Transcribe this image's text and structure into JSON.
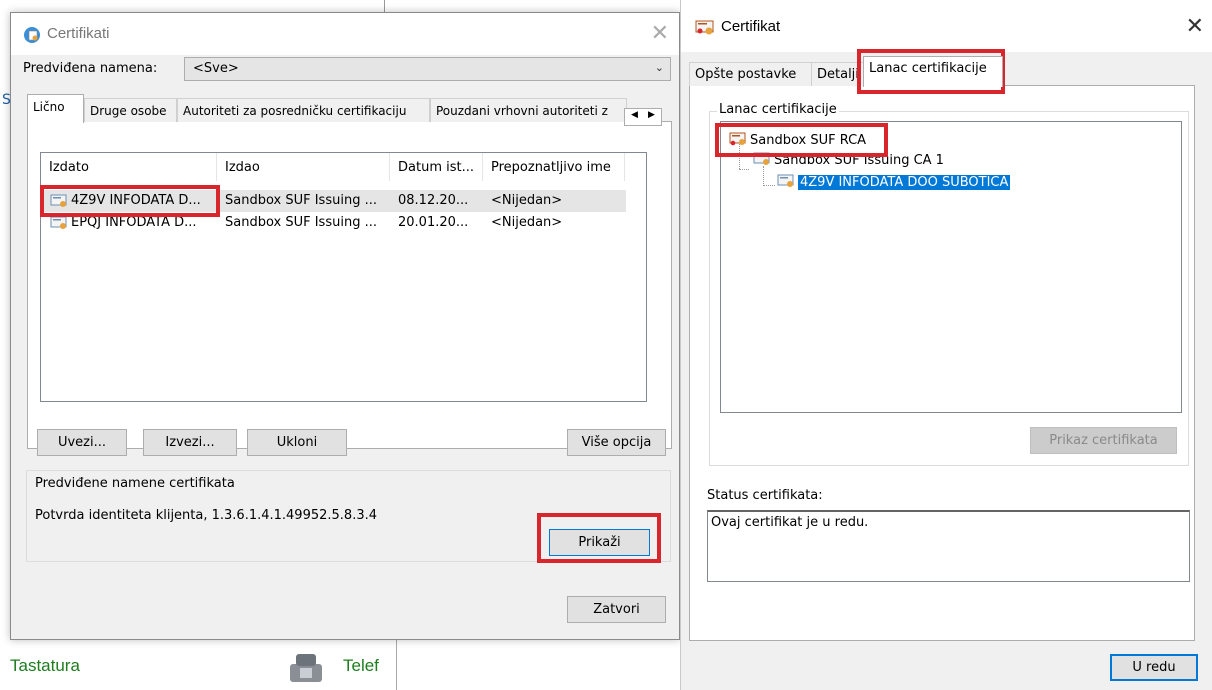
{
  "background": {
    "tastatura": "Tastatura",
    "telefon": "Telef",
    "edge_letter": "S"
  },
  "certifikati": {
    "title": "Certifikati",
    "purpose_label": "Predviđena namena:",
    "purpose_value": "<Sve>",
    "tabs": [
      {
        "label": "Lično"
      },
      {
        "label": "Druge osobe"
      },
      {
        "label": "Autoriteti za posredničku certifikaciju"
      },
      {
        "label": "Pouzdani vrhovni autoriteti z"
      }
    ],
    "columns": [
      "Izdato",
      "Izdao",
      "Datum ist...",
      "Prepoznatljivo ime"
    ],
    "rows": [
      {
        "issued_to": "4Z9V INFODATA D...",
        "issued_by": "Sandbox SUF Issuing ...",
        "date": "08.12.20...",
        "friendly": "<Nijedan>"
      },
      {
        "issued_to": "EPQJ INFODATA D...",
        "issued_by": "Sandbox SUF Issuing ...",
        "date": "20.01.20...",
        "friendly": "<Nijedan>"
      }
    ],
    "buttons": {
      "import": "Uvezi...",
      "export": "Izvezi...",
      "remove": "Ukloni",
      "advanced": "Više opcija",
      "view": "Prikaži",
      "close": "Zatvori"
    },
    "purposes_label": "Predviđene namene certifikata",
    "purposes_value": "Potvrda identiteta klijenta, 1.3.6.1.4.1.49952.5.8.3.4"
  },
  "certifikat": {
    "title": "Certifikat",
    "tabs": [
      {
        "label": "Opšte postavke"
      },
      {
        "label": "Detalji"
      },
      {
        "label": "Lanac certifikacije"
      }
    ],
    "chain_label": "Lanac certifikacije",
    "chain": [
      {
        "label": "Sandbox SUF RCA"
      },
      {
        "label": "Sandbox SUF Issuing CA 1"
      },
      {
        "label": "4Z9V INFODATA DOO SUBOTICA"
      }
    ],
    "view_cert_button": "Prikaz certifikata",
    "status_label": "Status certifikata:",
    "status_text": "Ovaj certifikat je u redu.",
    "ok_button": "U redu"
  },
  "colors": {
    "highlight_red": "#d8262c",
    "selection_blue": "#0078d7",
    "green_link": "#1e7d1e"
  }
}
